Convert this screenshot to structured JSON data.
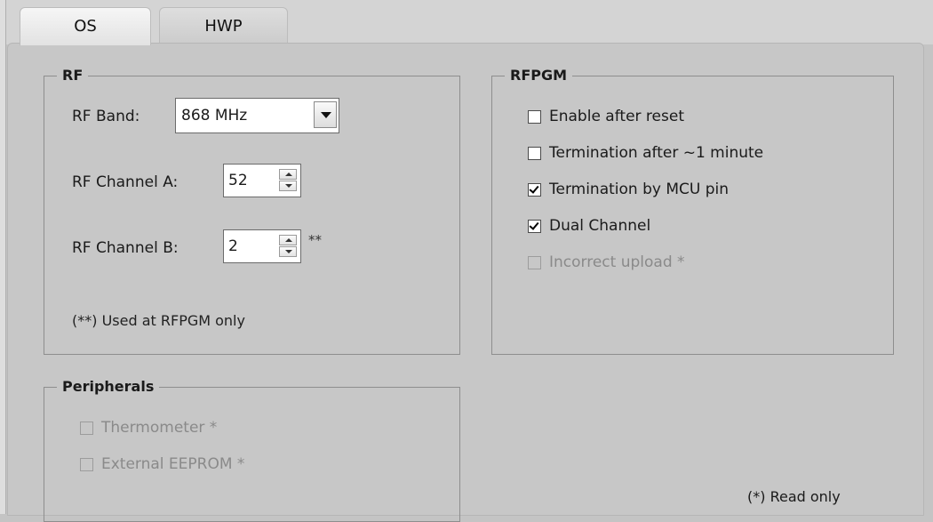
{
  "tabs": [
    {
      "label": "OS",
      "active": true
    },
    {
      "label": "HWP",
      "active": false
    }
  ],
  "rf": {
    "legend": "RF",
    "band_label": "RF Band:",
    "band_value": "868 MHz",
    "channel_a_label": "RF Channel A:",
    "channel_a_value": "52",
    "channel_b_label": "RF Channel B:",
    "channel_b_value": "2",
    "channel_b_marker": "**",
    "note": "(**) Used at RFPGM only"
  },
  "rfpgm": {
    "legend": "RFPGM",
    "options": [
      {
        "label": "Enable after reset",
        "checked": false,
        "enabled": true
      },
      {
        "label": "Termination after ~1 minute",
        "checked": false,
        "enabled": true
      },
      {
        "label": "Termination by MCU pin",
        "checked": true,
        "enabled": true
      },
      {
        "label": "Dual Channel",
        "checked": true,
        "enabled": true
      },
      {
        "label": "Incorrect upload *",
        "checked": false,
        "enabled": false
      }
    ]
  },
  "peripherals": {
    "legend": "Peripherals",
    "options": [
      {
        "label": "Thermometer *",
        "checked": false,
        "enabled": false
      },
      {
        "label": "External EEPROM *",
        "checked": false,
        "enabled": false
      }
    ]
  },
  "footnote": "(*) Read only",
  "icons": {
    "dropdown": "chevron-down-icon",
    "spinner": "spinner-arrows-icon"
  }
}
